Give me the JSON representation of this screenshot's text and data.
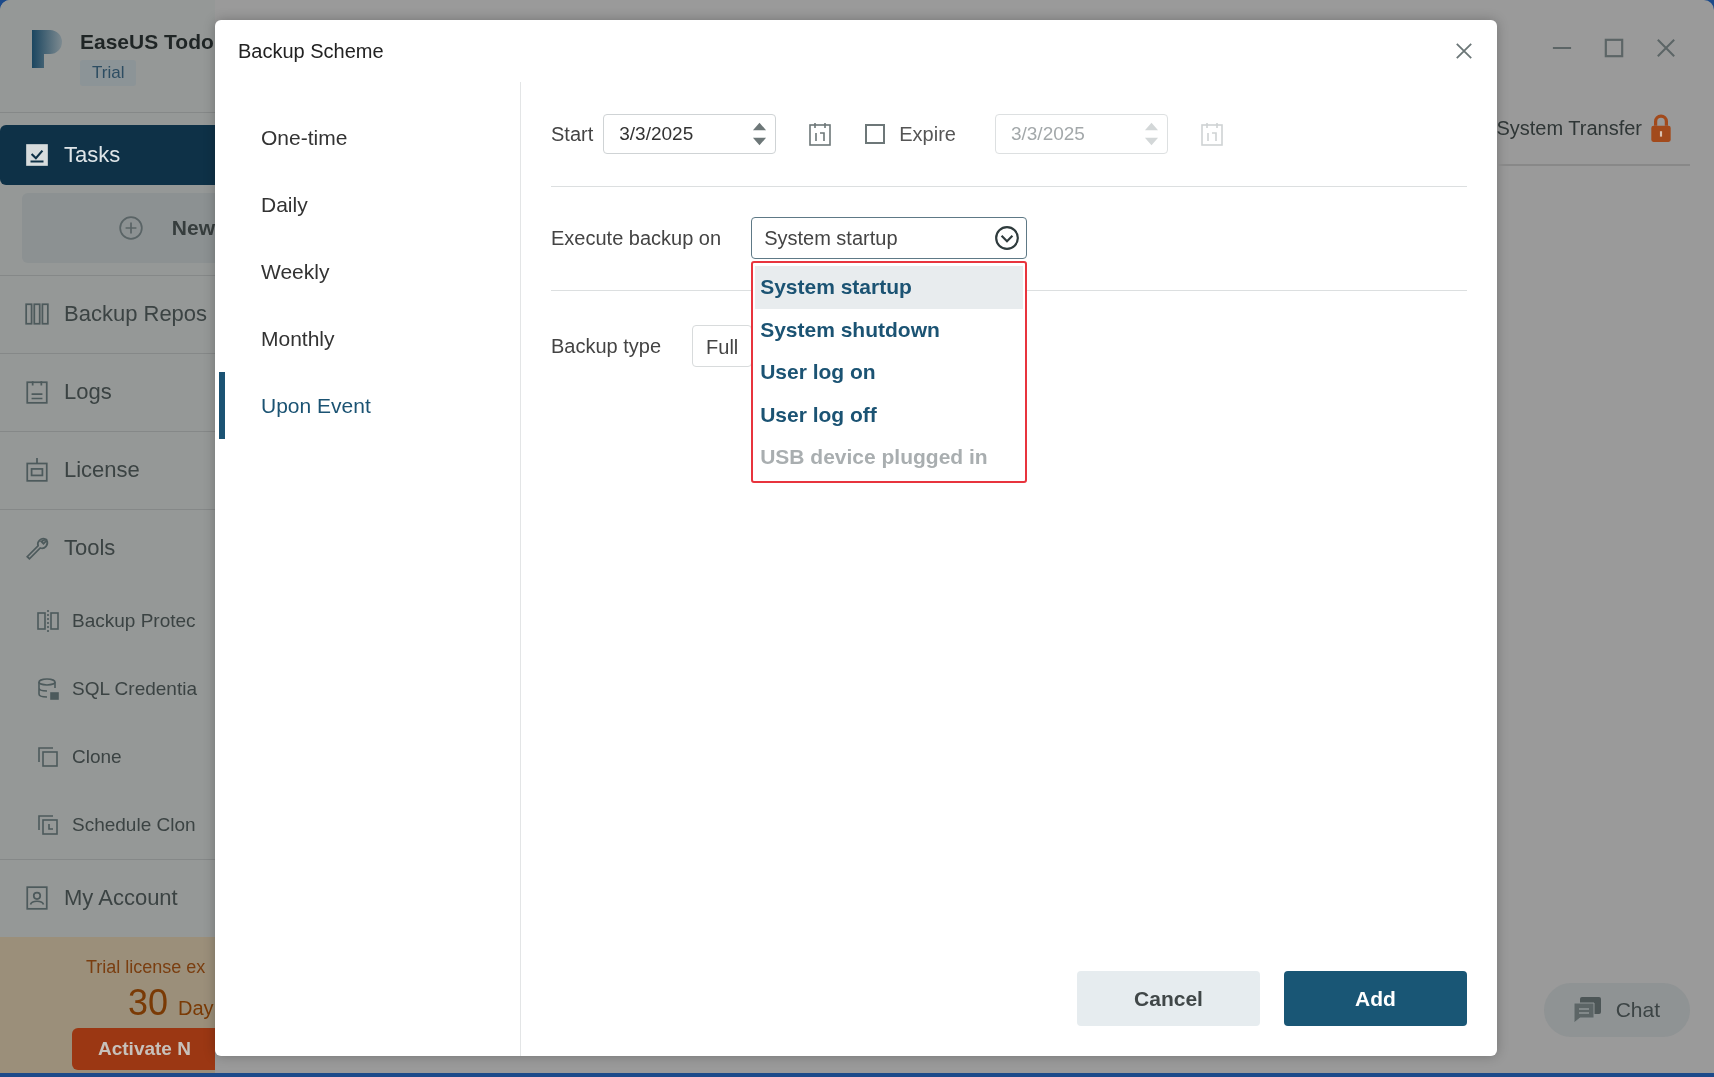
{
  "app": {
    "title": "EaseUS Todo",
    "badge": "Trial",
    "nav": [
      {
        "label": "Tasks",
        "kind": "main",
        "selected": true
      },
      {
        "label": "New",
        "kind": "button",
        "selected": false
      },
      {
        "label": "Backup Repos",
        "kind": "main",
        "selected": false
      },
      {
        "label": "Logs",
        "kind": "main",
        "selected": false
      },
      {
        "label": "License",
        "kind": "main",
        "selected": false
      },
      {
        "label": "Tools",
        "kind": "main",
        "selected": false
      },
      {
        "label": "Backup Protec",
        "kind": "sub",
        "selected": false
      },
      {
        "label": "SQL Credentia",
        "kind": "sub",
        "selected": false
      },
      {
        "label": "Clone",
        "kind": "sub",
        "selected": false
      },
      {
        "label": "Schedule Clon",
        "kind": "sub",
        "selected": false
      },
      {
        "label": "My Account",
        "kind": "main",
        "selected": false
      }
    ],
    "trial": {
      "text": "Trial license ex",
      "days": "30",
      "days_unit": "Day",
      "button": "Activate N"
    },
    "header_link": "System Transfer",
    "chat_button": "Chat"
  },
  "dialog": {
    "title": "Backup Scheme",
    "schedule_types": [
      {
        "label": "One-time",
        "selected": false
      },
      {
        "label": "Daily",
        "selected": false
      },
      {
        "label": "Weekly",
        "selected": false
      },
      {
        "label": "Monthly",
        "selected": false
      },
      {
        "label": "Upon Event",
        "selected": true
      }
    ],
    "start": {
      "label": "Start",
      "value": "3/3/2025"
    },
    "expire": {
      "label": "Expire",
      "checked": false,
      "value": "3/3/2025"
    },
    "execute": {
      "label": "Execute backup on",
      "value": "System startup",
      "options": [
        {
          "label": "System startup",
          "selected": true,
          "disabled": false
        },
        {
          "label": "System shutdown",
          "selected": false,
          "disabled": false
        },
        {
          "label": "User log on",
          "selected": false,
          "disabled": false
        },
        {
          "label": "User log off",
          "selected": false,
          "disabled": false
        },
        {
          "label": "USB device plugged in",
          "selected": false,
          "disabled": true
        }
      ]
    },
    "backup_type": {
      "label": "Backup type",
      "value": "Full"
    },
    "buttons": {
      "cancel": "Cancel",
      "add": "Add"
    }
  }
}
